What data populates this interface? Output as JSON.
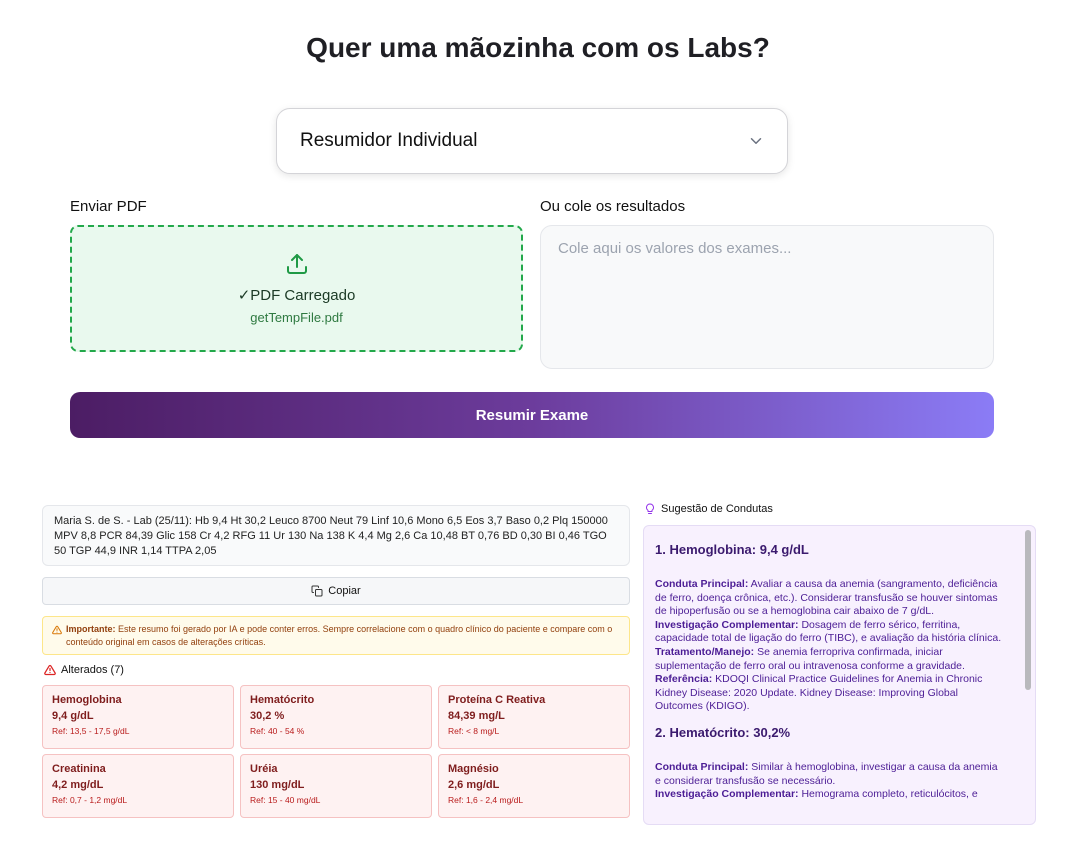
{
  "page": {
    "title": "Quer uma mãozinha com os Labs?"
  },
  "mode": {
    "selected": "Resumidor Individual"
  },
  "upload": {
    "label": "Enviar PDF",
    "status_mark": "✓",
    "status": "PDF Carregado",
    "filename": "getTempFile.pdf"
  },
  "paste": {
    "label": "Ou cole os resultados",
    "placeholder": "Cole aqui os valores dos exames...",
    "value": ""
  },
  "submit": {
    "label": "Resumir Exame"
  },
  "result": {
    "summary": "Maria S. de S. - Lab (25/11): Hb 9,4 Ht 30,2 Leuco 8700 Neut 79 Linf 10,6 Mono 6,5 Eos 3,7 Baso 0,2 Plq 150000 MPV 8,8 PCR 84,39 Glic 158 Cr 4,2 RFG 11 Ur 130 Na 138 K 4,4 Mg 2,6 Ca 10,48 BT 0,76 BD 0,30 BI 0,46 TGO 50 TGP 44,9 INR 1,14 TTPA 2,05",
    "copy_label": "Copiar",
    "warning_strong": "Importante:",
    "warning_text": " Este resumo foi gerado por IA e pode conter erros. Sempre correlacione com o quadro clínico do paciente e compare com o conteúdo original em casos de alterações críticas.",
    "altered_title": "Alterados (7)",
    "altered": [
      {
        "name": "Hemoglobina",
        "value": "9,4 g/dL",
        "ref": "Ref: 13,5 - 17,5 g/dL"
      },
      {
        "name": "Hematócrito",
        "value": "30,2 %",
        "ref": "Ref: 40 - 54 %"
      },
      {
        "name": "Proteína C Reativa",
        "value": "84,39 mg/L",
        "ref": "Ref: < 8 mg/L"
      },
      {
        "name": "Creatinina",
        "value": "4,2 mg/dL",
        "ref": "Ref: 0,7 - 1,2 mg/dL"
      },
      {
        "name": "Uréia",
        "value": "130 mg/dL",
        "ref": "Ref: 15 - 40 mg/dL"
      },
      {
        "name": "Magnésio",
        "value": "2,6 mg/dL",
        "ref": "Ref: 1,6 - 2,4 mg/dL"
      }
    ]
  },
  "suggestions": {
    "title": "Sugestão de Condutas",
    "items": [
      {
        "heading": "1. Hemoglobina: 9,4 g/dL",
        "k1": "Conduta Principal:",
        "t1": " Avaliar a causa da anemia (sangramento, deficiência de ferro, doença crônica, etc.). Considerar transfusão se houver sintomas de hipoperfusão ou se a hemoglobina cair abaixo de 7 g/dL.",
        "k2": "Investigação Complementar:",
        "t2": " Dosagem de ferro sérico, ferritina, capacidade total de ligação do ferro (TIBC), e avaliação da história clínica.",
        "k3": "Tratamento/Manejo:",
        "t3": " Se anemia ferropriva confirmada, iniciar suplementação de ferro oral ou intravenosa conforme a gravidade.",
        "k4": "Referência:",
        "t4": " KDOQI Clinical Practice Guidelines for Anemia in Chronic Kidney Disease: 2020 Update. Kidney Disease: Improving Global Outcomes (KDIGO)."
      },
      {
        "heading": "2. Hematócrito: 30,2%",
        "k1": "Conduta Principal:",
        "t1": " Similar à hemoglobina, investigar a causa da anemia e considerar transfusão se necessário.",
        "k2": "Investigação Complementar:",
        "t2": " Hemograma completo, reticulócitos, e"
      }
    ]
  },
  "colors": {
    "accent_start": "#4c1d64",
    "accent_end": "#8b7cf6",
    "upload_ok": "#22a84a",
    "alert": "#7f1d1d",
    "suggestion_text": "#4c1d95"
  }
}
